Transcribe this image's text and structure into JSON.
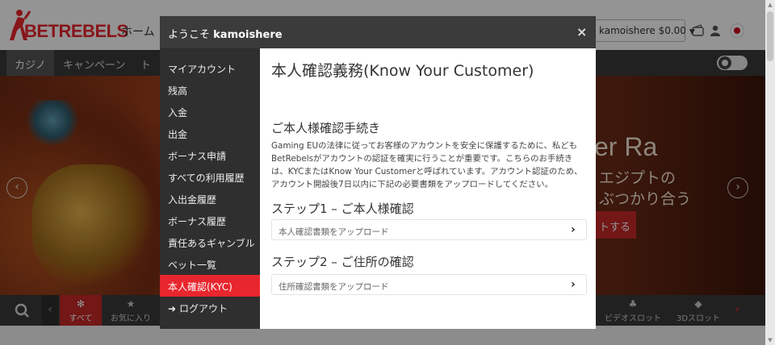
{
  "site": {
    "logo_text_a": "BET",
    "logo_text_b": "REBELS",
    "nav_home": "ホーム",
    "account_button": "kamoishere $0.00",
    "categories": [
      "カジノ",
      "キャンペーン",
      "ト"
    ],
    "banner": {
      "title": "er Ra",
      "line1": "エジプトの",
      "line2": "ぶつかり合う",
      "cta": "トする"
    },
    "game_tabs": [
      {
        "icon": "✻",
        "label": "すべて"
      },
      {
        "icon": "★",
        "label": "お気に入り"
      },
      {
        "icon": "♣",
        "label": "ビデオスロット"
      },
      {
        "icon": "◆",
        "label": "3Dスロット"
      }
    ],
    "colors": {
      "brand_red": "#e8262d",
      "dark_bar": "#3a3a3a"
    }
  },
  "modal": {
    "welcome": "ようこそ",
    "username": "kamoishere",
    "close_label": "×",
    "menu": [
      "マイアカウント",
      "残高",
      "入金",
      "出金",
      "ボーナス申請",
      "すべての利用履歴",
      "入出金履歴",
      "ボーナス履歴",
      "責任あるギャンブル",
      "ベット一覧",
      "本人確認(KYC)",
      "ログアウト"
    ],
    "active_menu": "本人確認(KYC)",
    "content": {
      "title": "本人確認義務(Know Your Customer)",
      "section_title": "ご本人様確認手続き",
      "description": "Gaming EUの法律に従ってお客様のアカウントを安全に保護するために、私どもBetRebelsがアカウントの認証を確実に行うことが重要です。こちらのお手続きは、KYCまたはKnow Your Customerと呼ばれています。アカウント認証のため、アカウント開設後7日以内に下記の必要書類をアップロードしてください。",
      "step1_title": "ステップ1 – ご本人様確認",
      "step1_upload": "本人確認書類をアップロード",
      "step2_title": "ステップ2 – ご住所の確認",
      "step2_upload": "住所確認書類をアップロード"
    }
  }
}
